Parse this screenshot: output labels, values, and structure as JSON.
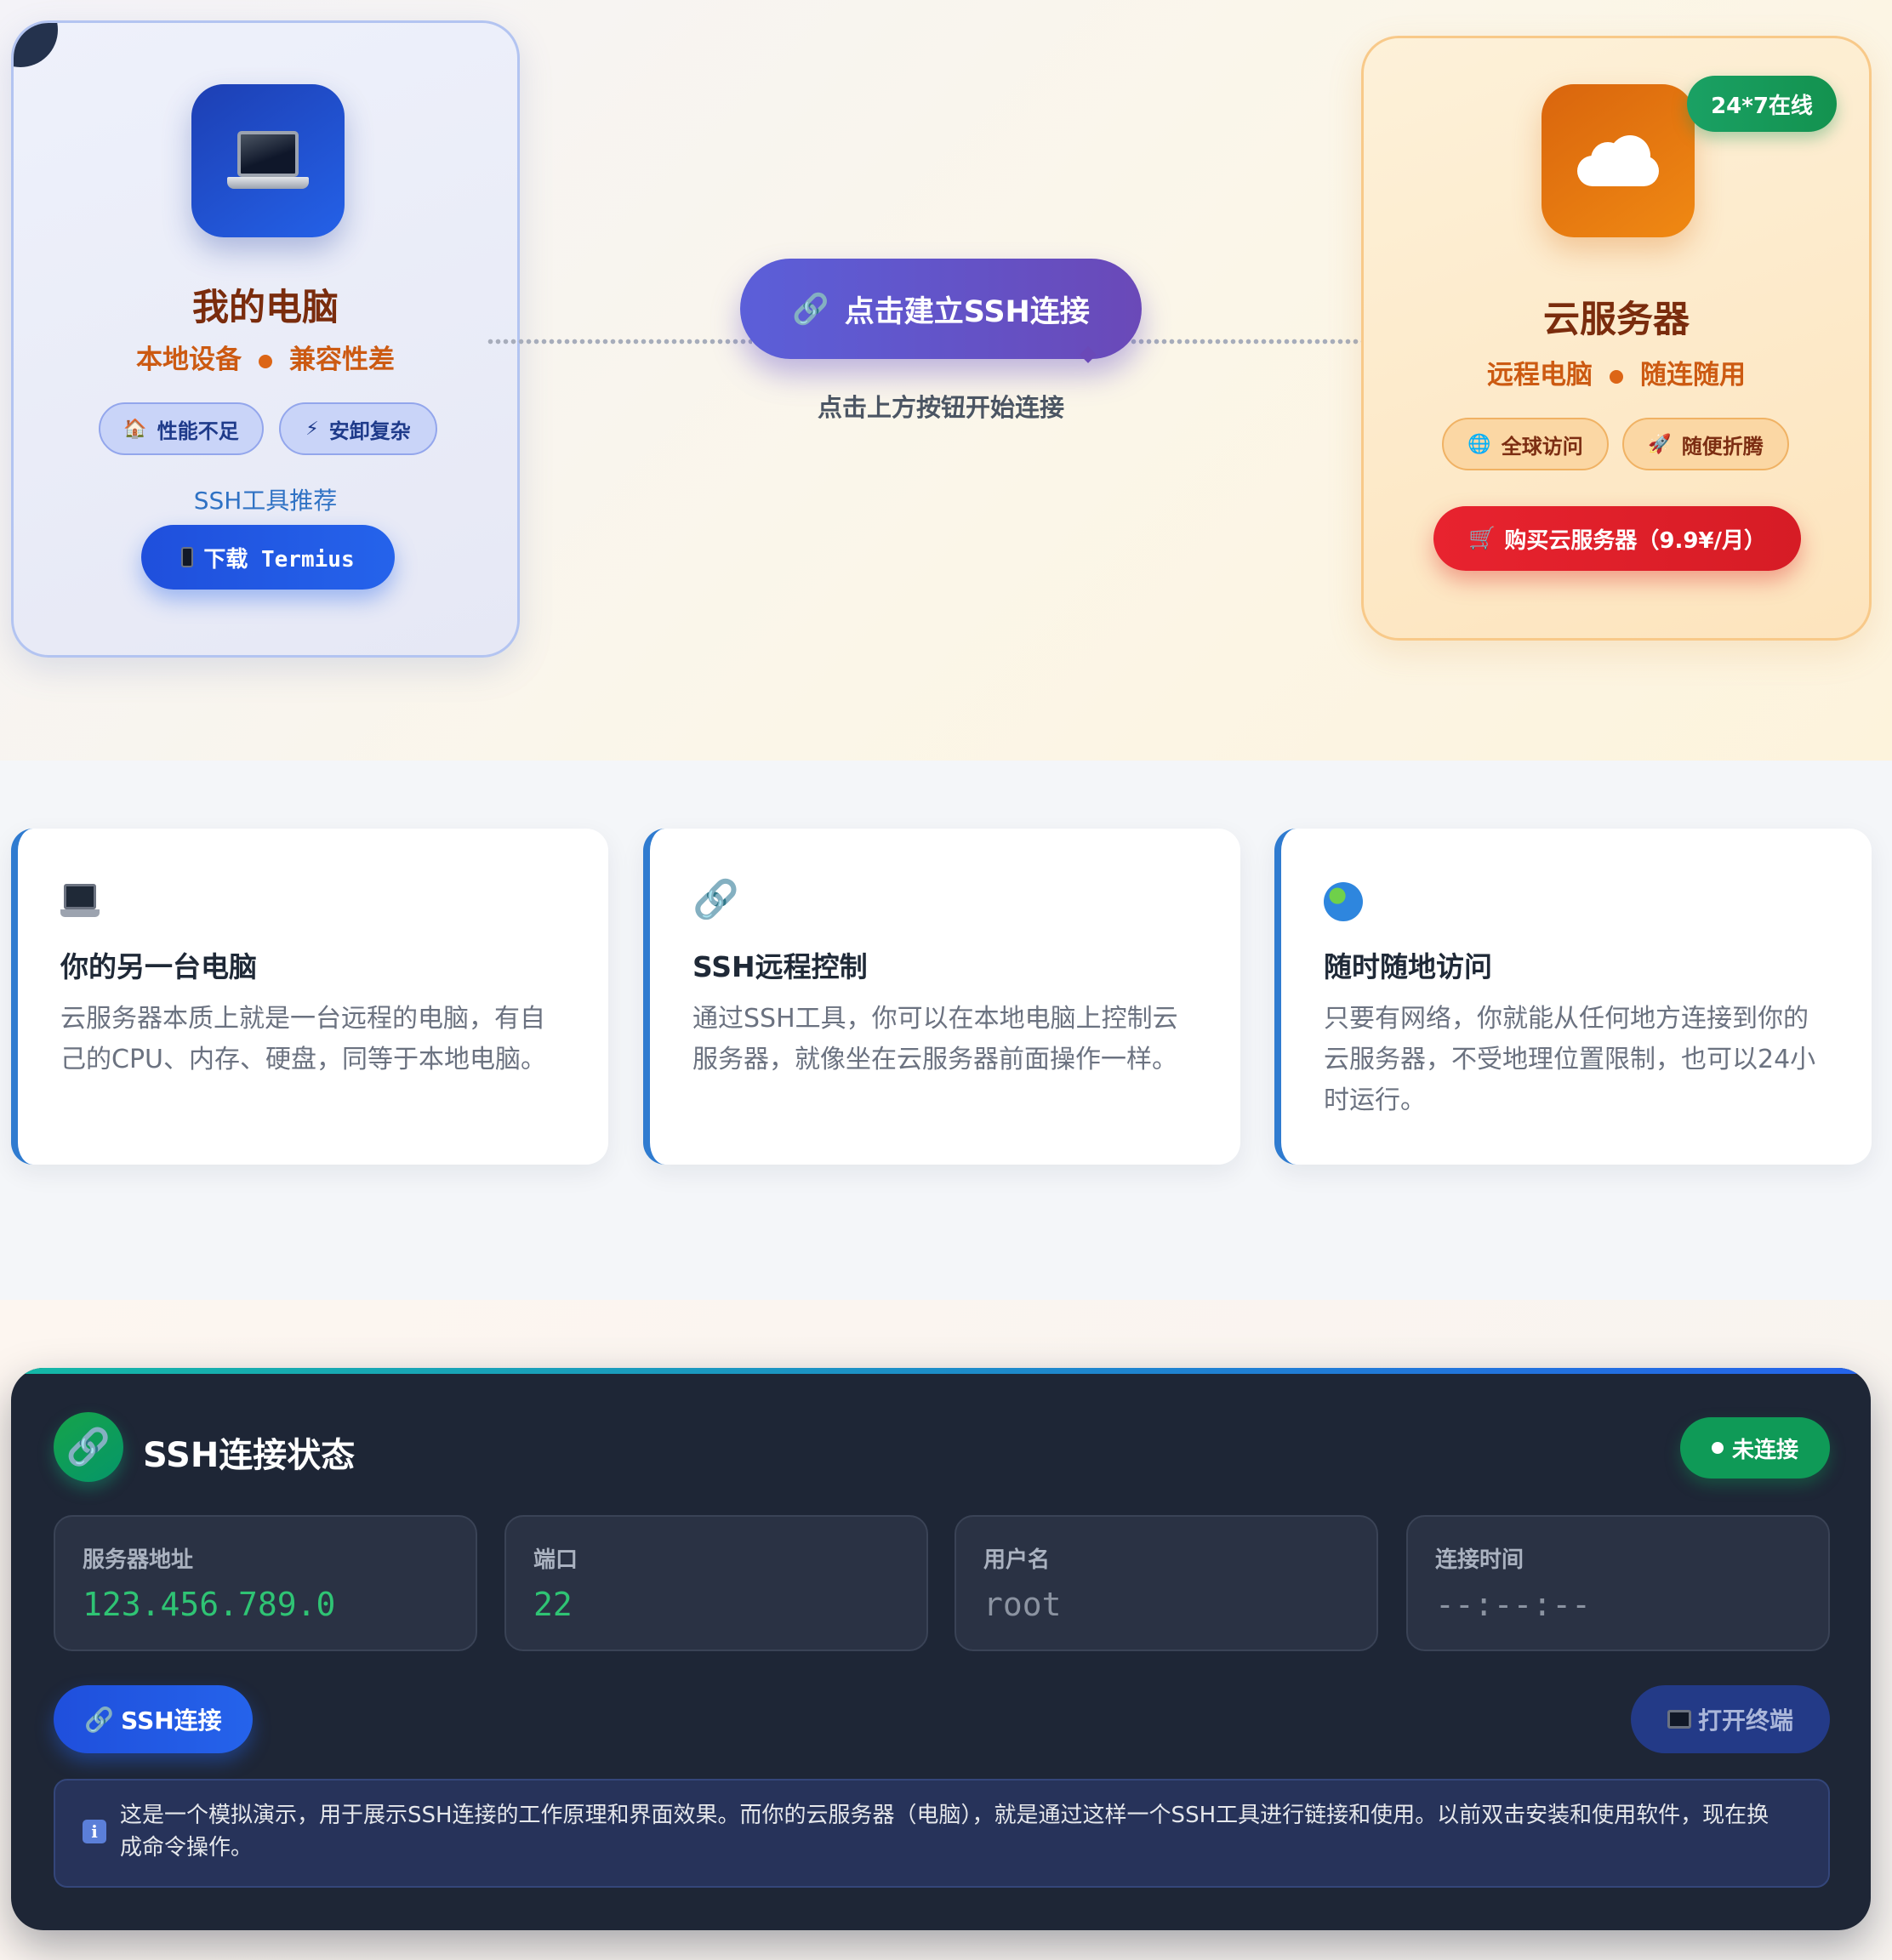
{
  "hero": {
    "local": {
      "title": "我的电脑",
      "sub_left": "本地设备",
      "sub_right": "兼容性差",
      "tag1_icon": "🏠",
      "tag1": "性能不足",
      "tag2_icon": "⚡",
      "tag2": "安卸复杂",
      "tool_label": "SSH工具推荐",
      "download": "下载 Termius"
    },
    "connect_button": "点击建立SSH连接",
    "connect_icon": "🔗",
    "hint": "点击上方按钮开始连接",
    "cloud": {
      "badge": "24*7在线",
      "title": "云服务器",
      "sub_left": "远程电脑",
      "sub_right": "随连随用",
      "tag1_icon": "🌐",
      "tag1": "全球访问",
      "tag2_icon": "🚀",
      "tag2": "随便折腾",
      "buy_icon": "🛒",
      "buy": "购买云服务器（9.9¥/月）"
    }
  },
  "features": [
    {
      "icon": "laptop-icon",
      "title": "你的另一台电脑",
      "desc": "云服务器本质上就是一台远程的电脑，有自己的CPU、内存、硬盘，同等于本地电脑。"
    },
    {
      "icon": "link-icon",
      "icon_glyph": "🔗",
      "title": "SSH远程控制",
      "desc": "通过SSH工具，你可以在本地电脑上控制云服务器，就像坐在云服务器前面操作一样。"
    },
    {
      "icon": "globe-icon",
      "title": "随时随地访问",
      "desc": "只要有网络，你就能从任何地方连接到你的云服务器，不受地理位置限制，也可以24小时运行。"
    }
  ],
  "ssh": {
    "title": "SSH连接状态",
    "status": "未连接",
    "fields": [
      {
        "label": "服务器地址",
        "value": "123.456.789.0"
      },
      {
        "label": "端口",
        "value": "22"
      },
      {
        "label": "用户名",
        "value": "root"
      },
      {
        "label": "连接时间",
        "value": "--:--:--"
      }
    ],
    "connect_button": "SSH连接",
    "terminal_button": "打开终端",
    "notice": "这是一个模拟演示，用于展示SSH连接的工作原理和界面效果。而你的云服务器（电脑），就是通过这样一个SSH工具进行链接和使用。以前双击安装和使用软件，现在换成命令操作。"
  },
  "colors": {
    "accent_blue": "#2563eb",
    "accent_purple": "#5b5fd9",
    "accent_orange": "#f08913",
    "accent_red": "#e8232f",
    "status_green": "#0f9a57"
  }
}
